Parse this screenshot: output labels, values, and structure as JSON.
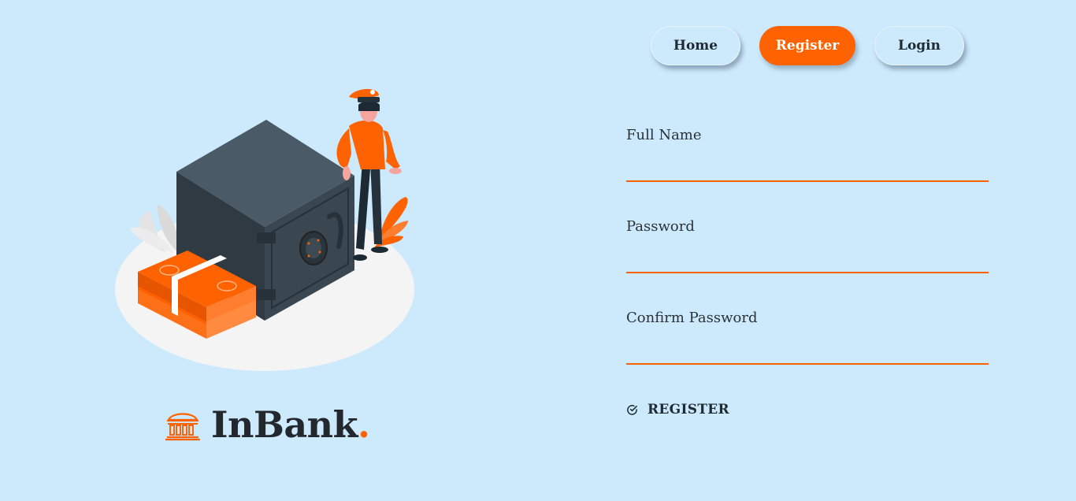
{
  "nav": {
    "items": [
      {
        "label": "Home"
      },
      {
        "label": "Register"
      },
      {
        "label": "Login"
      }
    ],
    "active": "Register"
  },
  "brand": {
    "name": "InBank",
    "dot": ".",
    "icon": "bank-building-icon"
  },
  "illustration": {
    "icon": "safe-with-guard-and-money-illustration"
  },
  "form": {
    "fields": [
      {
        "label": "Full Name",
        "value": "",
        "type": "text"
      },
      {
        "label": "Password",
        "value": "",
        "type": "password"
      },
      {
        "label": "Confirm Password",
        "value": "",
        "type": "password"
      }
    ],
    "submit_label": "REGISTER",
    "submit_icon": "check-circle-icon"
  },
  "colors": {
    "background": "#cdeafd",
    "accent": "#ff6200",
    "text": "#22282d"
  }
}
